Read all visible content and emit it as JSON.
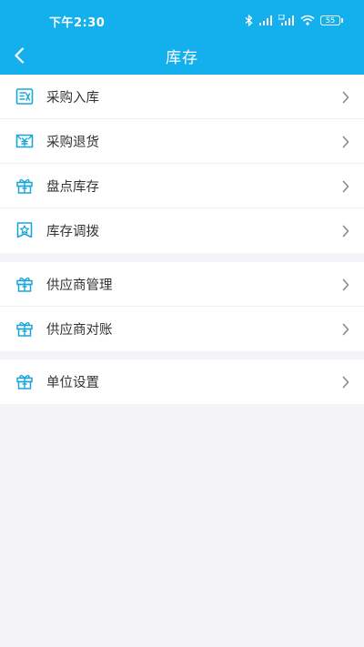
{
  "status_bar": {
    "time": "下午2:30",
    "battery": "55"
  },
  "header": {
    "title": "库存"
  },
  "groups": [
    {
      "items": [
        {
          "label": "采购入库",
          "icon": "purchase-in-icon"
        },
        {
          "label": "采购退货",
          "icon": "purchase-return-icon"
        },
        {
          "label": "盘点库存",
          "icon": "gift-box-icon"
        },
        {
          "label": "库存调拨",
          "icon": "star-tag-icon"
        }
      ]
    },
    {
      "items": [
        {
          "label": "供应商管理",
          "icon": "gift-box-icon"
        },
        {
          "label": "供应商对账",
          "icon": "gift-box-icon"
        }
      ]
    },
    {
      "items": [
        {
          "label": "单位设置",
          "icon": "gift-box-icon"
        }
      ]
    }
  ],
  "colors": {
    "header": "#14b0ee",
    "icon": "#1aa5d8",
    "background": "#f4f4f8"
  }
}
